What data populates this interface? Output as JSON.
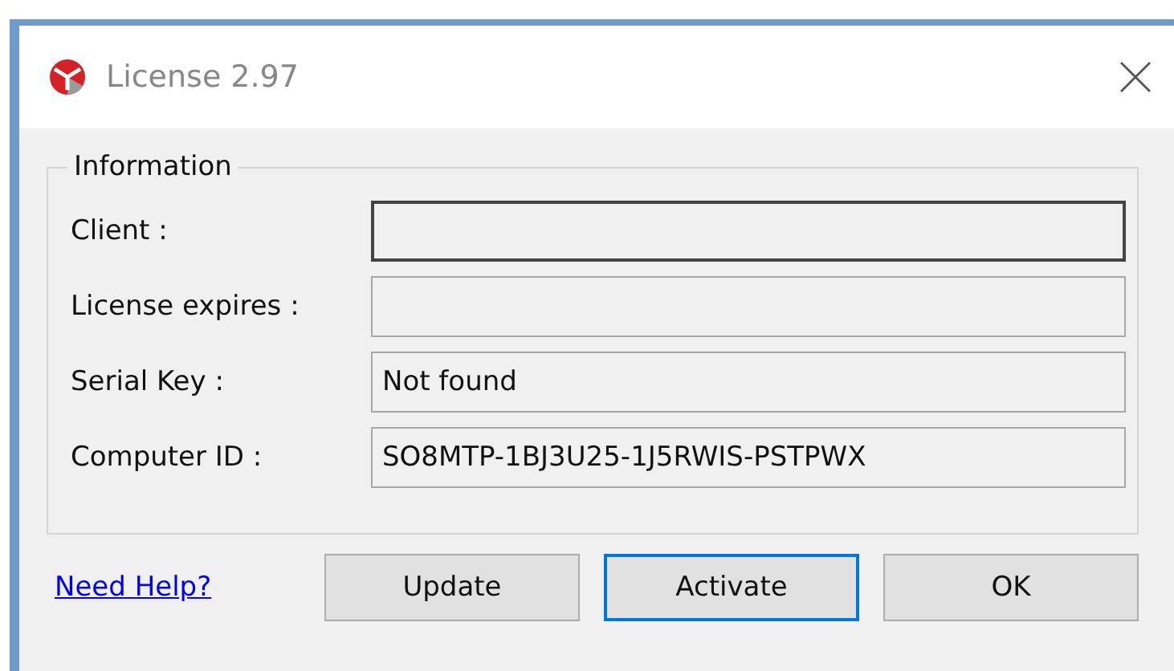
{
  "window": {
    "title": "License 2.97"
  },
  "group": {
    "title": "Information",
    "fields": [
      {
        "label": "Client :",
        "focused": true
      },
      {
        "label": "License expires :",
        "focused": false
      },
      {
        "label": "Serial Key :",
        "value": "Not found",
        "focused": false
      },
      {
        "label": "Computer ID :",
        "value": "SO8MTP-1BJ3U25-1J5RWIS-PSTPWX",
        "focused": false
      }
    ]
  },
  "help_link": "Need Help?",
  "buttons": [
    {
      "label": "Update",
      "focused": false
    },
    {
      "label": "Activate",
      "focused": true
    },
    {
      "label": "OK",
      "focused": false
    }
  ]
}
